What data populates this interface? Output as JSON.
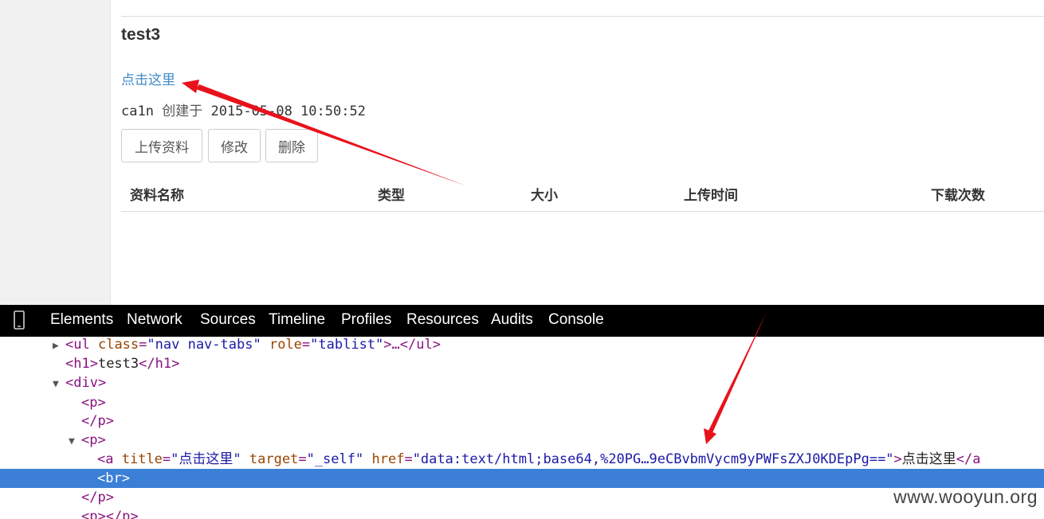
{
  "page": {
    "title": "test3",
    "link_text": "点击这里",
    "meta_user": "ca1n",
    "meta_label": "创建于",
    "meta_datetime": "2015-05-08 10:50:52",
    "buttons": {
      "upload": "上传资料",
      "edit": "修改",
      "delete": "删除"
    },
    "table_headers": [
      "资料名称",
      "类型",
      "大小",
      "上传时间",
      "下载次数"
    ]
  },
  "devtools": {
    "device_icon": "mobile-device-icon",
    "tabs": [
      "Elements",
      "Network",
      "Sources",
      "Timeline",
      "Profiles",
      "Resources",
      "Audits",
      "Console"
    ],
    "tree": {
      "ul_open": "<ul",
      "ul_class_attr": "class",
      "ul_class_val": "\"nav nav-tabs\"",
      "ul_role_attr": "role",
      "ul_role_val": "\"tablist\"",
      "ul_rest": ">…</ul>",
      "h1_open": "<h1>",
      "h1_text": "test3",
      "h1_close": "</h1>",
      "div_open": "<div>",
      "p_open": "<p>",
      "p_close": "</p>",
      "a_open": "<a",
      "a_title_attr": "title",
      "a_title_val": "\"点击这里\"",
      "a_target_attr": "target",
      "a_target_val": "\"_self\"",
      "a_href_attr": "href",
      "a_href_val": "\"data:text/html;base64,%20PG…9eCBvbmVycm9yPWFsZXJ0KDEpPg==\"",
      "a_gt": ">",
      "a_text": "点击这里",
      "a_close": "</a",
      "br": "<br>",
      "p_empty": "<p></p>"
    }
  },
  "watermark": "www.wooyun.org",
  "colors": {
    "link": "#428bca",
    "selection": "#3b7fd6",
    "arrow": "#e8121b",
    "devtools_bar": "#000000"
  }
}
